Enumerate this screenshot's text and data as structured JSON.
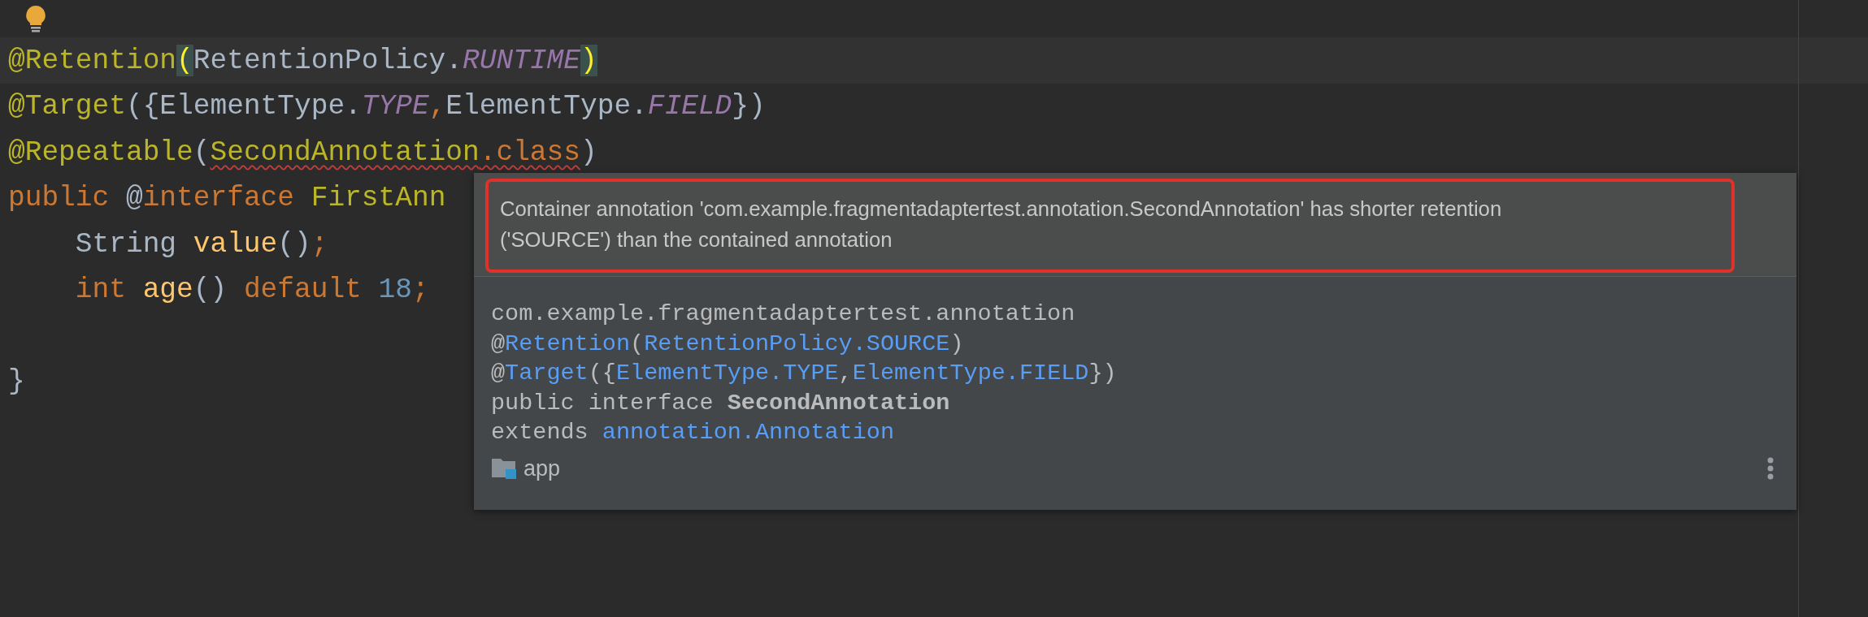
{
  "code_lines": [
    {
      "current": true,
      "tokens": [
        {
          "text": "@Retention",
          "kind": "annotation"
        },
        {
          "text": "(",
          "kind": "brace-match"
        },
        {
          "text": "RetentionPolicy.",
          "kind": "plain"
        },
        {
          "text": "RUNTIME",
          "kind": "constant"
        },
        {
          "text": ")",
          "kind": "brace-match"
        }
      ]
    },
    {
      "current": false,
      "tokens": [
        {
          "text": "@Target",
          "kind": "annotation"
        },
        {
          "text": "({ElementType.",
          "kind": "plain"
        },
        {
          "text": "TYPE",
          "kind": "constant"
        },
        {
          "text": ",",
          "kind": "keyword"
        },
        {
          "text": "ElementType.",
          "kind": "plain"
        },
        {
          "text": "FIELD",
          "kind": "constant"
        },
        {
          "text": "})",
          "kind": "plain"
        }
      ]
    },
    {
      "current": false,
      "tokens": [
        {
          "text": "@Repeatable",
          "kind": "annotation"
        },
        {
          "text": "(",
          "kind": "plain"
        },
        {
          "text": "SecondAnnotation",
          "kind": "annotation",
          "error": true
        },
        {
          "text": ".class",
          "kind": "keyword",
          "error": true
        },
        {
          "text": ")",
          "kind": "plain"
        }
      ]
    },
    {
      "current": false,
      "tokens": [
        {
          "text": "public",
          "kind": "keyword"
        },
        {
          "text": " @",
          "kind": "plain"
        },
        {
          "text": "interface ",
          "kind": "keyword"
        },
        {
          "text": "FirstAnn",
          "kind": "annotation"
        }
      ],
      "children": [
        {
          "current": false,
          "tokens": [
            {
              "text": "String ",
              "kind": "plain"
            },
            {
              "text": "value",
              "kind": "method"
            },
            {
              "text": "()",
              "kind": "plain"
            },
            {
              "text": ";",
              "kind": "keyword"
            }
          ]
        },
        {
          "current": false,
          "tokens": [
            {
              "text": "int ",
              "kind": "keyword"
            },
            {
              "text": "age",
              "kind": "method"
            },
            {
              "text": "() ",
              "kind": "plain"
            },
            {
              "text": "default ",
              "kind": "keyword"
            },
            {
              "text": "18",
              "kind": "number"
            },
            {
              "text": ";",
              "kind": "keyword"
            }
          ]
        }
      ]
    },
    {
      "current": false,
      "tokens": [
        {
          "text": "}",
          "kind": "plain"
        }
      ]
    }
  ],
  "popup": {
    "message": "Container annotation 'com.example.fragmentadaptertest.annotation.SecondAnnotation' has shorter retention ('SOURCE') than the contained annotation",
    "doc_lines": [
      [
        {
          "text": "com.example.fragmentadaptertest.annotation",
          "kind": "plain"
        }
      ],
      [
        {
          "text": "@",
          "kind": "plain"
        },
        {
          "text": "Retention",
          "kind": "link"
        },
        {
          "text": "(",
          "kind": "plain"
        },
        {
          "text": "RetentionPolicy.SOURCE",
          "kind": "link"
        },
        {
          "text": ")",
          "kind": "plain"
        }
      ],
      [
        {
          "text": "@",
          "kind": "plain"
        },
        {
          "text": "Target",
          "kind": "link"
        },
        {
          "text": "({",
          "kind": "plain"
        },
        {
          "text": "ElementType.TYPE",
          "kind": "link"
        },
        {
          "text": ",",
          "kind": "plain"
        },
        {
          "text": "ElementType.FIELD",
          "kind": "link"
        },
        {
          "text": "})",
          "kind": "plain"
        }
      ],
      [
        {
          "text": "public interface ",
          "kind": "plain"
        },
        {
          "text": "SecondAnnotation",
          "kind": "bold"
        }
      ],
      [
        {
          "text": "extends ",
          "kind": "plain"
        },
        {
          "text": "annotation.Annotation",
          "kind": "link"
        }
      ]
    ],
    "module": "app"
  }
}
